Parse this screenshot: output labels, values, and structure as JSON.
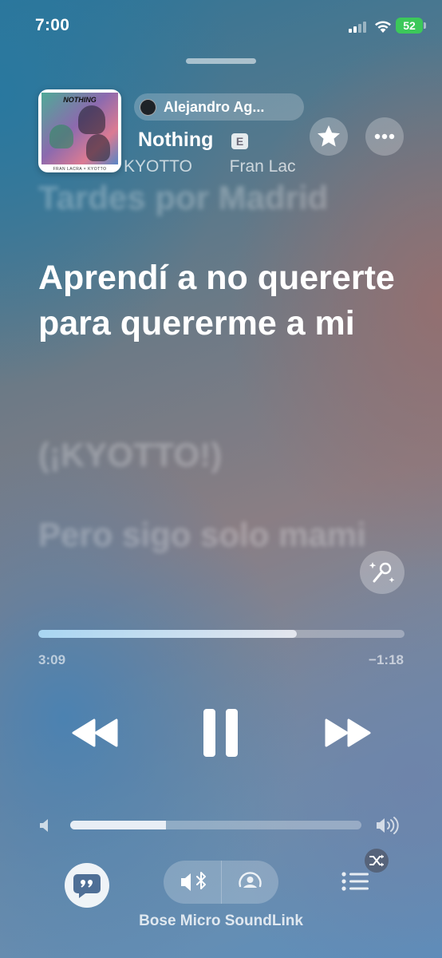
{
  "status_bar": {
    "time": "7:00",
    "battery": "52",
    "battery_color": "#3cc85a"
  },
  "now_playing": {
    "shared_by": "Alejandro Ag...",
    "title": "Nothing",
    "explicit_badge": "E",
    "artists_visible": "KYOTTO        Fran Lac",
    "artwork": {
      "title": "NOTHING",
      "caption": "FRAN LACRA × KYOTTO"
    }
  },
  "lyrics": {
    "previous": "Tardes por Madrid",
    "current": "Aprendí a no quererte para quererme a mi",
    "next": [
      "(¡KYOTTO!)",
      "Pero sigo solo mami"
    ]
  },
  "playback": {
    "elapsed": "3:09",
    "remaining": "−1:18",
    "progress_fraction": 0.705,
    "state": "playing",
    "volume_fraction": 0.33
  },
  "output": {
    "device_name": "Bose Micro SoundLink"
  },
  "icons": {
    "favorite": "star-icon",
    "more": "ellipsis-icon",
    "sing": "microphone-sparkle-icon",
    "rewind": "rewind-icon",
    "pause": "pause-icon",
    "forward": "fast-forward-icon",
    "lyrics": "quote-bubble-icon",
    "bluetooth": "speaker-bluetooth-icon",
    "airplay": "airplay-icon",
    "queue": "list-icon",
    "shuffle": "shuffle-icon"
  }
}
